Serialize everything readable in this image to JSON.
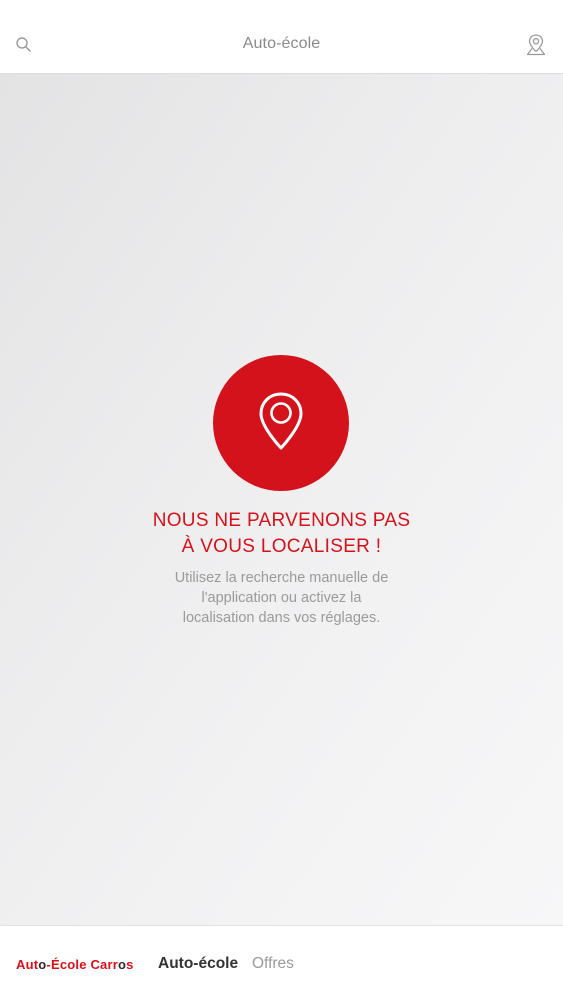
{
  "header": {
    "title": "Auto-école",
    "search_icon": "search-icon",
    "locate_icon": "location-pin-icon"
  },
  "error": {
    "icon": "location-pin-icon",
    "title_line1": "NOUS NE PARVENONS PAS",
    "title_line2": "À VOUS LOCALISER !",
    "message_line1": "Utilisez la recherche manuelle de",
    "message_line2": "l'application ou activez la",
    "message_line3": "localisation dans vos réglages."
  },
  "footer": {
    "brand_part1": "Aut",
    "brand_part2": "o",
    "brand_part3": "-École Carr",
    "brand_part4": "o",
    "brand_part5": "s",
    "nav": [
      {
        "label": "Auto-école",
        "active": true
      },
      {
        "label": "Offres",
        "active": false
      }
    ]
  },
  "colors": {
    "accent": "#d3121c",
    "muted_text": "#9a9a9a"
  }
}
